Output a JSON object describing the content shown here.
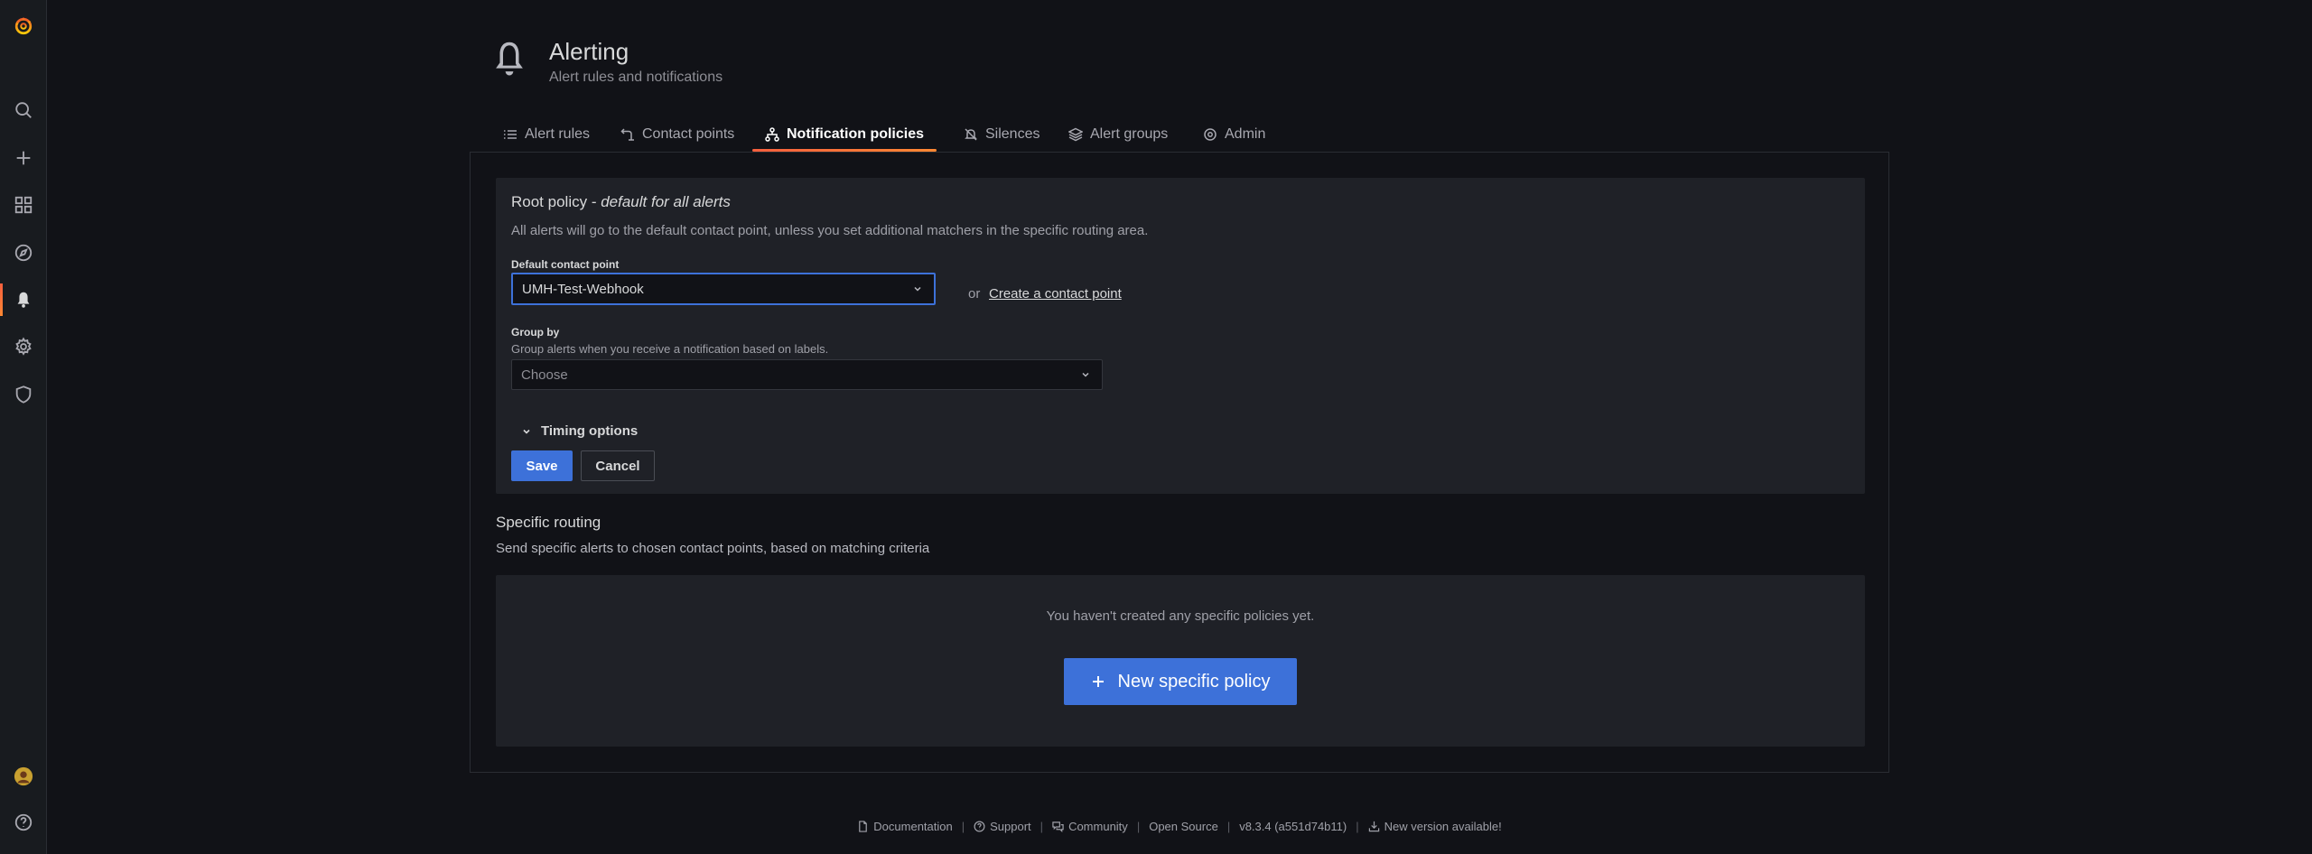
{
  "sidebar": {
    "items": [
      {
        "name": "logo"
      },
      {
        "name": "search"
      },
      {
        "name": "create"
      },
      {
        "name": "dashboards"
      },
      {
        "name": "explore"
      },
      {
        "name": "alerting"
      },
      {
        "name": "configuration"
      },
      {
        "name": "server-admin"
      },
      {
        "name": "profile"
      },
      {
        "name": "help"
      }
    ]
  },
  "header": {
    "title": "Alerting",
    "subtitle": "Alert rules and notifications"
  },
  "tabs": [
    {
      "label": "Alert rules",
      "icon": "list-icon"
    },
    {
      "label": "Contact points",
      "icon": "contact-icon"
    },
    {
      "label": "Notification policies",
      "icon": "sitemap-icon",
      "active": true
    },
    {
      "label": "Silences",
      "icon": "bell-slash-icon"
    },
    {
      "label": "Alert groups",
      "icon": "layer-group-icon"
    },
    {
      "label": "Admin",
      "icon": "cog-icon"
    }
  ],
  "root_policy": {
    "title": "Root policy - ",
    "title_em": "default for all alerts",
    "description": "All alerts will go to the default contact point, unless you set additional matchers in the specific routing area.",
    "contact_label": "Default contact point",
    "contact_value": "UMH-Test-Webhook",
    "or_text": "or",
    "create_link": "Create a contact point",
    "group_label": "Group by",
    "group_help": "Group alerts when you receive a notification based on labels.",
    "group_placeholder": "Choose",
    "timing_label": "Timing options",
    "save_label": "Save",
    "cancel_label": "Cancel"
  },
  "specific_routing": {
    "title": "Specific routing",
    "description": "Send specific alerts to chosen contact points, based on matching criteria",
    "empty_text": "You haven't created any specific policies yet.",
    "new_button": "New specific policy"
  },
  "footer": {
    "documentation": "Documentation",
    "support": "Support",
    "community": "Community",
    "open_source": "Open Source",
    "version": "v8.3.4 (a551d74b11)",
    "new_version": "New version available!"
  },
  "colors": {
    "accent": "#3d71d9",
    "brand": "#f55f3e",
    "background": "#111217",
    "panel": "#1f2127"
  }
}
